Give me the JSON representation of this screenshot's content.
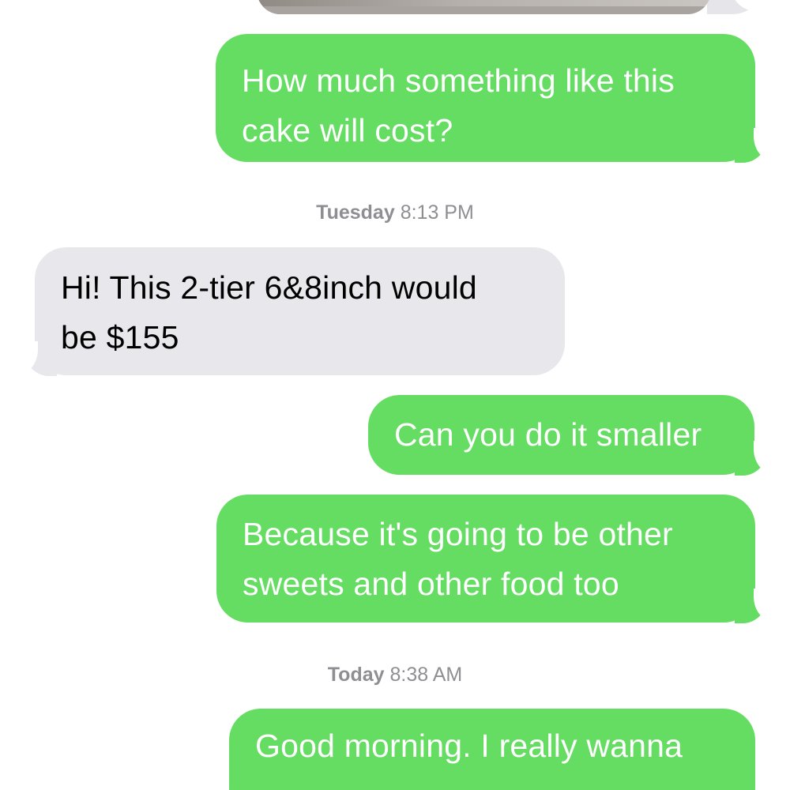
{
  "conversation": {
    "messages": [
      {
        "sender": "me",
        "lines": [
          "How much something like this",
          "cake will cost?"
        ]
      },
      {
        "sender": "them",
        "lines": [
          "Hi! This 2-tier 6&8inch would",
          "be $155"
        ]
      },
      {
        "sender": "me",
        "lines": [
          "Can you do it smaller"
        ]
      },
      {
        "sender": "me",
        "lines": [
          "Because it's going to be other",
          "sweets and other food too"
        ]
      },
      {
        "sender": "me",
        "lines": [
          "Good morning. I really wanna"
        ]
      }
    ],
    "timestamps": [
      {
        "day": "Tuesday",
        "time": "8:13 PM"
      },
      {
        "day": "Today",
        "time": "8:38 AM"
      }
    ]
  },
  "colors": {
    "sent_bubble": "#65dc62",
    "received_bubble": "#e8e7ec",
    "timestamp_text": "#8e8e93"
  }
}
